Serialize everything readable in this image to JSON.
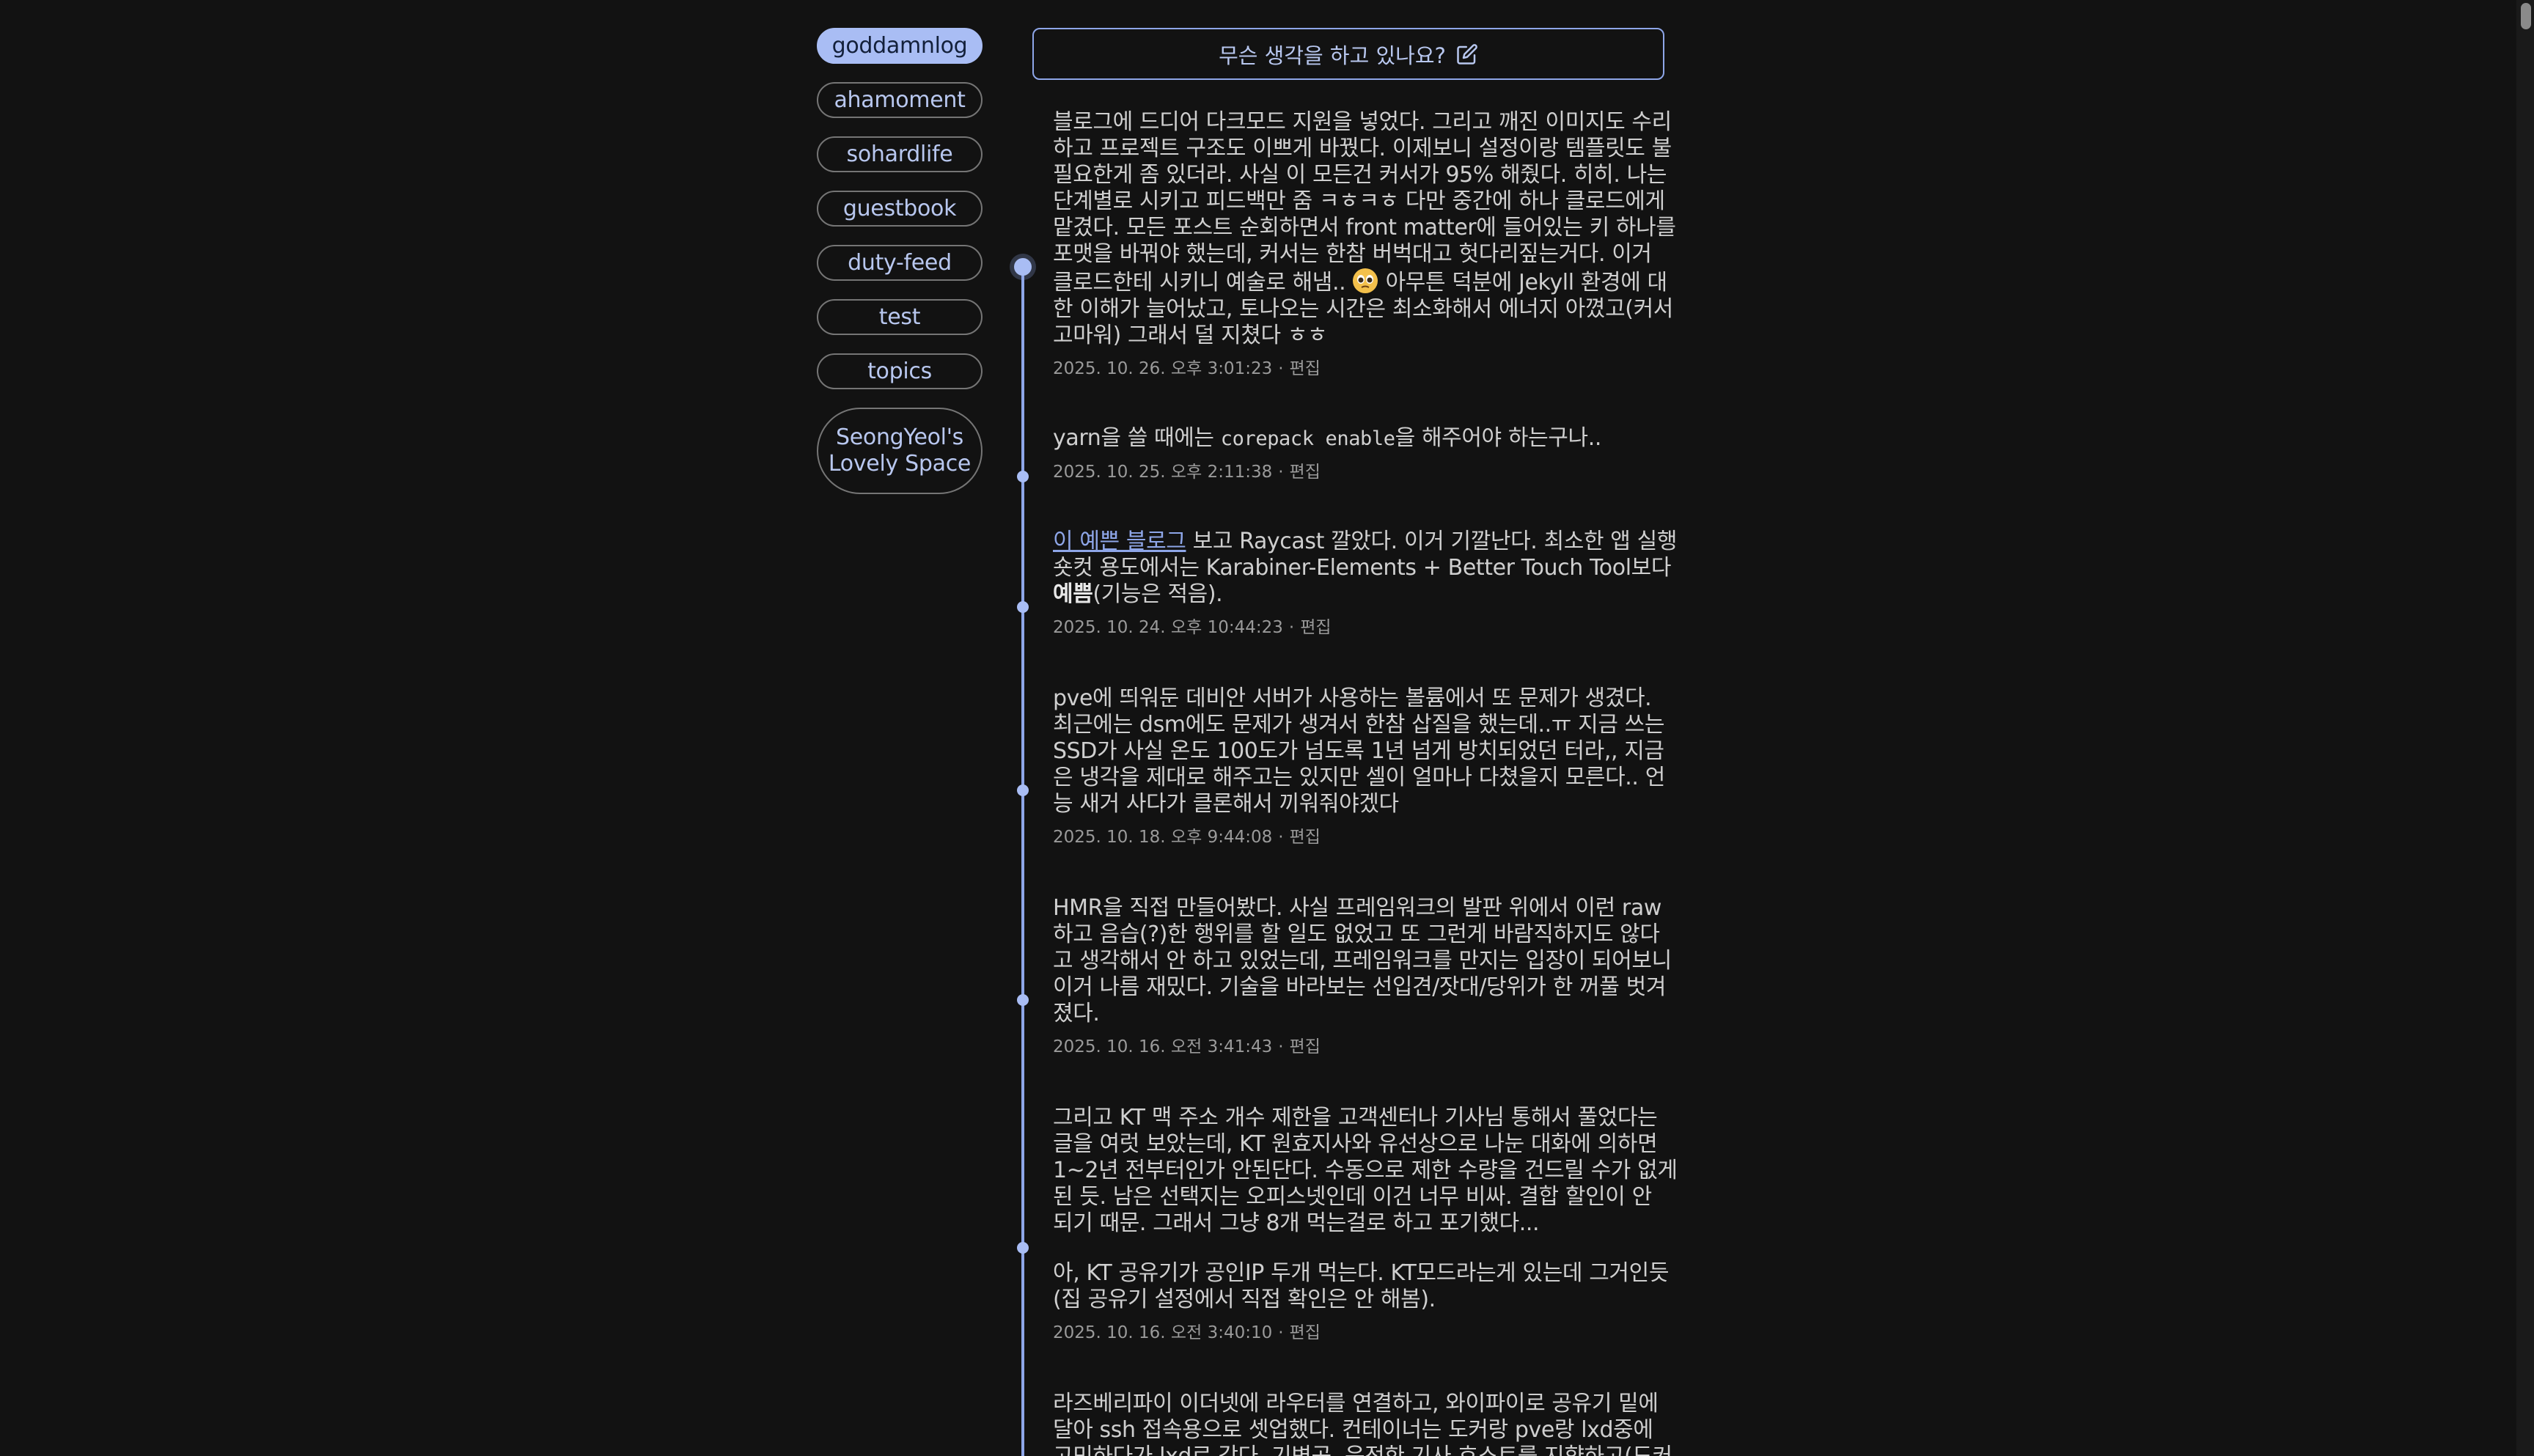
{
  "nav": {
    "items": [
      {
        "label": "goddamnlog",
        "active": true
      },
      {
        "label": "ahamoment"
      },
      {
        "label": "sohardlife"
      },
      {
        "label": "guestbook"
      },
      {
        "label": "duty-feed"
      },
      {
        "label": "test"
      },
      {
        "label": "topics"
      },
      {
        "label": "SeongYeol's Lovely Space"
      }
    ]
  },
  "compose": {
    "placeholder": "무슨 생각을 하고 있나요?",
    "icon": "edit-icon"
  },
  "colors": {
    "background": "#121212",
    "accent": "#8ea6e8",
    "active_pill": "#a9bdf4",
    "text": "#cfcfcf",
    "meta": "#9a9a9a"
  },
  "posts": [
    {
      "text_a": "블로그에 드디어 다크모드 지원을 넣었다. 그리고 깨진 이미지도 수리하고 프로젝트 구조도 이쁘게 바꿨다. 이제보니 설정이랑 템플릿도 불필요한게 좀 있더라. 사실 이 모든건 커서가 95% 해줬다. 히히. 나는 단계별로 시키고 피드백만 줌 ㅋㅎㅋㅎ 다만 중간에 하나 클로드에게 맡겼다. 모든 포스트 순회하면서 front matter에 들어있는 키 하나를 포맷을 바꿔야 했는데, 커서는 한참 버벅대고 헛다리짚는거다. 이거 클로드한테 시키니 예술로 해냄..",
      "text_b": "아무튼 덕분에 Jekyll 환경에 대한 이해가 늘어났고, 토나오는 시간은 최소화해서 에너지 아꼈고(커서 고마워) 그래서 덜 지쳤다 ㅎㅎ",
      "emoji": "pleading-face-emoji",
      "timestamp": "2025. 10. 26. 오후 3:01:23",
      "edit_label": "편집"
    },
    {
      "text_a": "yarn을 쓸 때에는 ",
      "code": "corepack enable",
      "text_b": "을 해주어야 하는구나..",
      "timestamp": "2025. 10. 25. 오후 2:11:38",
      "edit_label": "편집"
    },
    {
      "link_text": "이 예쁜 블로그",
      "text_a": " 보고 Raycast 깔았다. 이거 기깔난다. 최소한 앱 실행 숏컷 용도에서는 Karabiner-Elements + Better Touch Tool보다 ",
      "bold_text": "예쁨",
      "text_b": "(기능은 적음).",
      "timestamp": "2025. 10. 24. 오후 10:44:23",
      "edit_label": "편집"
    },
    {
      "text_a": "pve에 띄워둔 데비안 서버가 사용하는 볼륨에서 또 문제가 생겼다. 최근에는 dsm에도 문제가 생겨서 한참 삽질을 했는데..ㅠ 지금 쓰는 SSD가 사실 온도 100도가 넘도록 1년 넘게 방치되었던 터라,, 지금은 냉각을 제대로 해주고는 있지만 셀이 얼마나 다쳤을지 모른다.. 언능 새거 사다가 클론해서 끼워줘야겠다",
      "timestamp": "2025. 10. 18. 오후 9:44:08",
      "edit_label": "편집"
    },
    {
      "text_a": "HMR을 직접 만들어봤다. 사실 프레임워크의 발판 위에서 이런 raw하고 음습(?)한 행위를 할 일도 없었고 또 그런게 바람직하지도 않다고 생각해서 안 하고 있었는데, 프레임워크를 만지는 입장이 되어보니 이거 나름 재밌다. 기술을 바라보는 선입견/잣대/당위가 한 꺼풀 벗겨졌다.",
      "timestamp": "2025. 10. 16. 오전 3:41:43",
      "edit_label": "편집"
    },
    {
      "text_a": "그리고 KT 맥 주소 개수 제한을 고객센터나 기사님 통해서 풀었다는 글을 여럿 보았는데, KT 원효지사와 유선상으로 나눈 대화에 의하면 1~2년 전부터인가 안된단다. 수동으로 제한 수량을 건드릴 수가 없게 된 듯. 남은 선택지는 오피스넷인데 이건 너무 비싸. 결합 할인이 안 되기 때문. 그래서 그냥 8개 먹는걸로 하고 포기했다...",
      "text_b": "아, KT 공유기가 공인IP 두개 먹는다. KT모드라는게 있는데 그거인듯(집 공유기 설정에서 직접 확인은 안 해봄).",
      "timestamp": "2025. 10. 16. 오전 3:40:10",
      "edit_label": "편집"
    },
    {
      "text_a": "라즈베리파이 이더넷에 라우터를 연결하고, 와이파이로 공유기 밑에 달아 ssh 접속용으로 셋업했다. 컨테이너는 도커랑 pve랑 lxd중에 고민하다가 lxd로 갔다. 기변곡, 운전한 기사 호스트를 지향하고(도커"
    }
  ]
}
